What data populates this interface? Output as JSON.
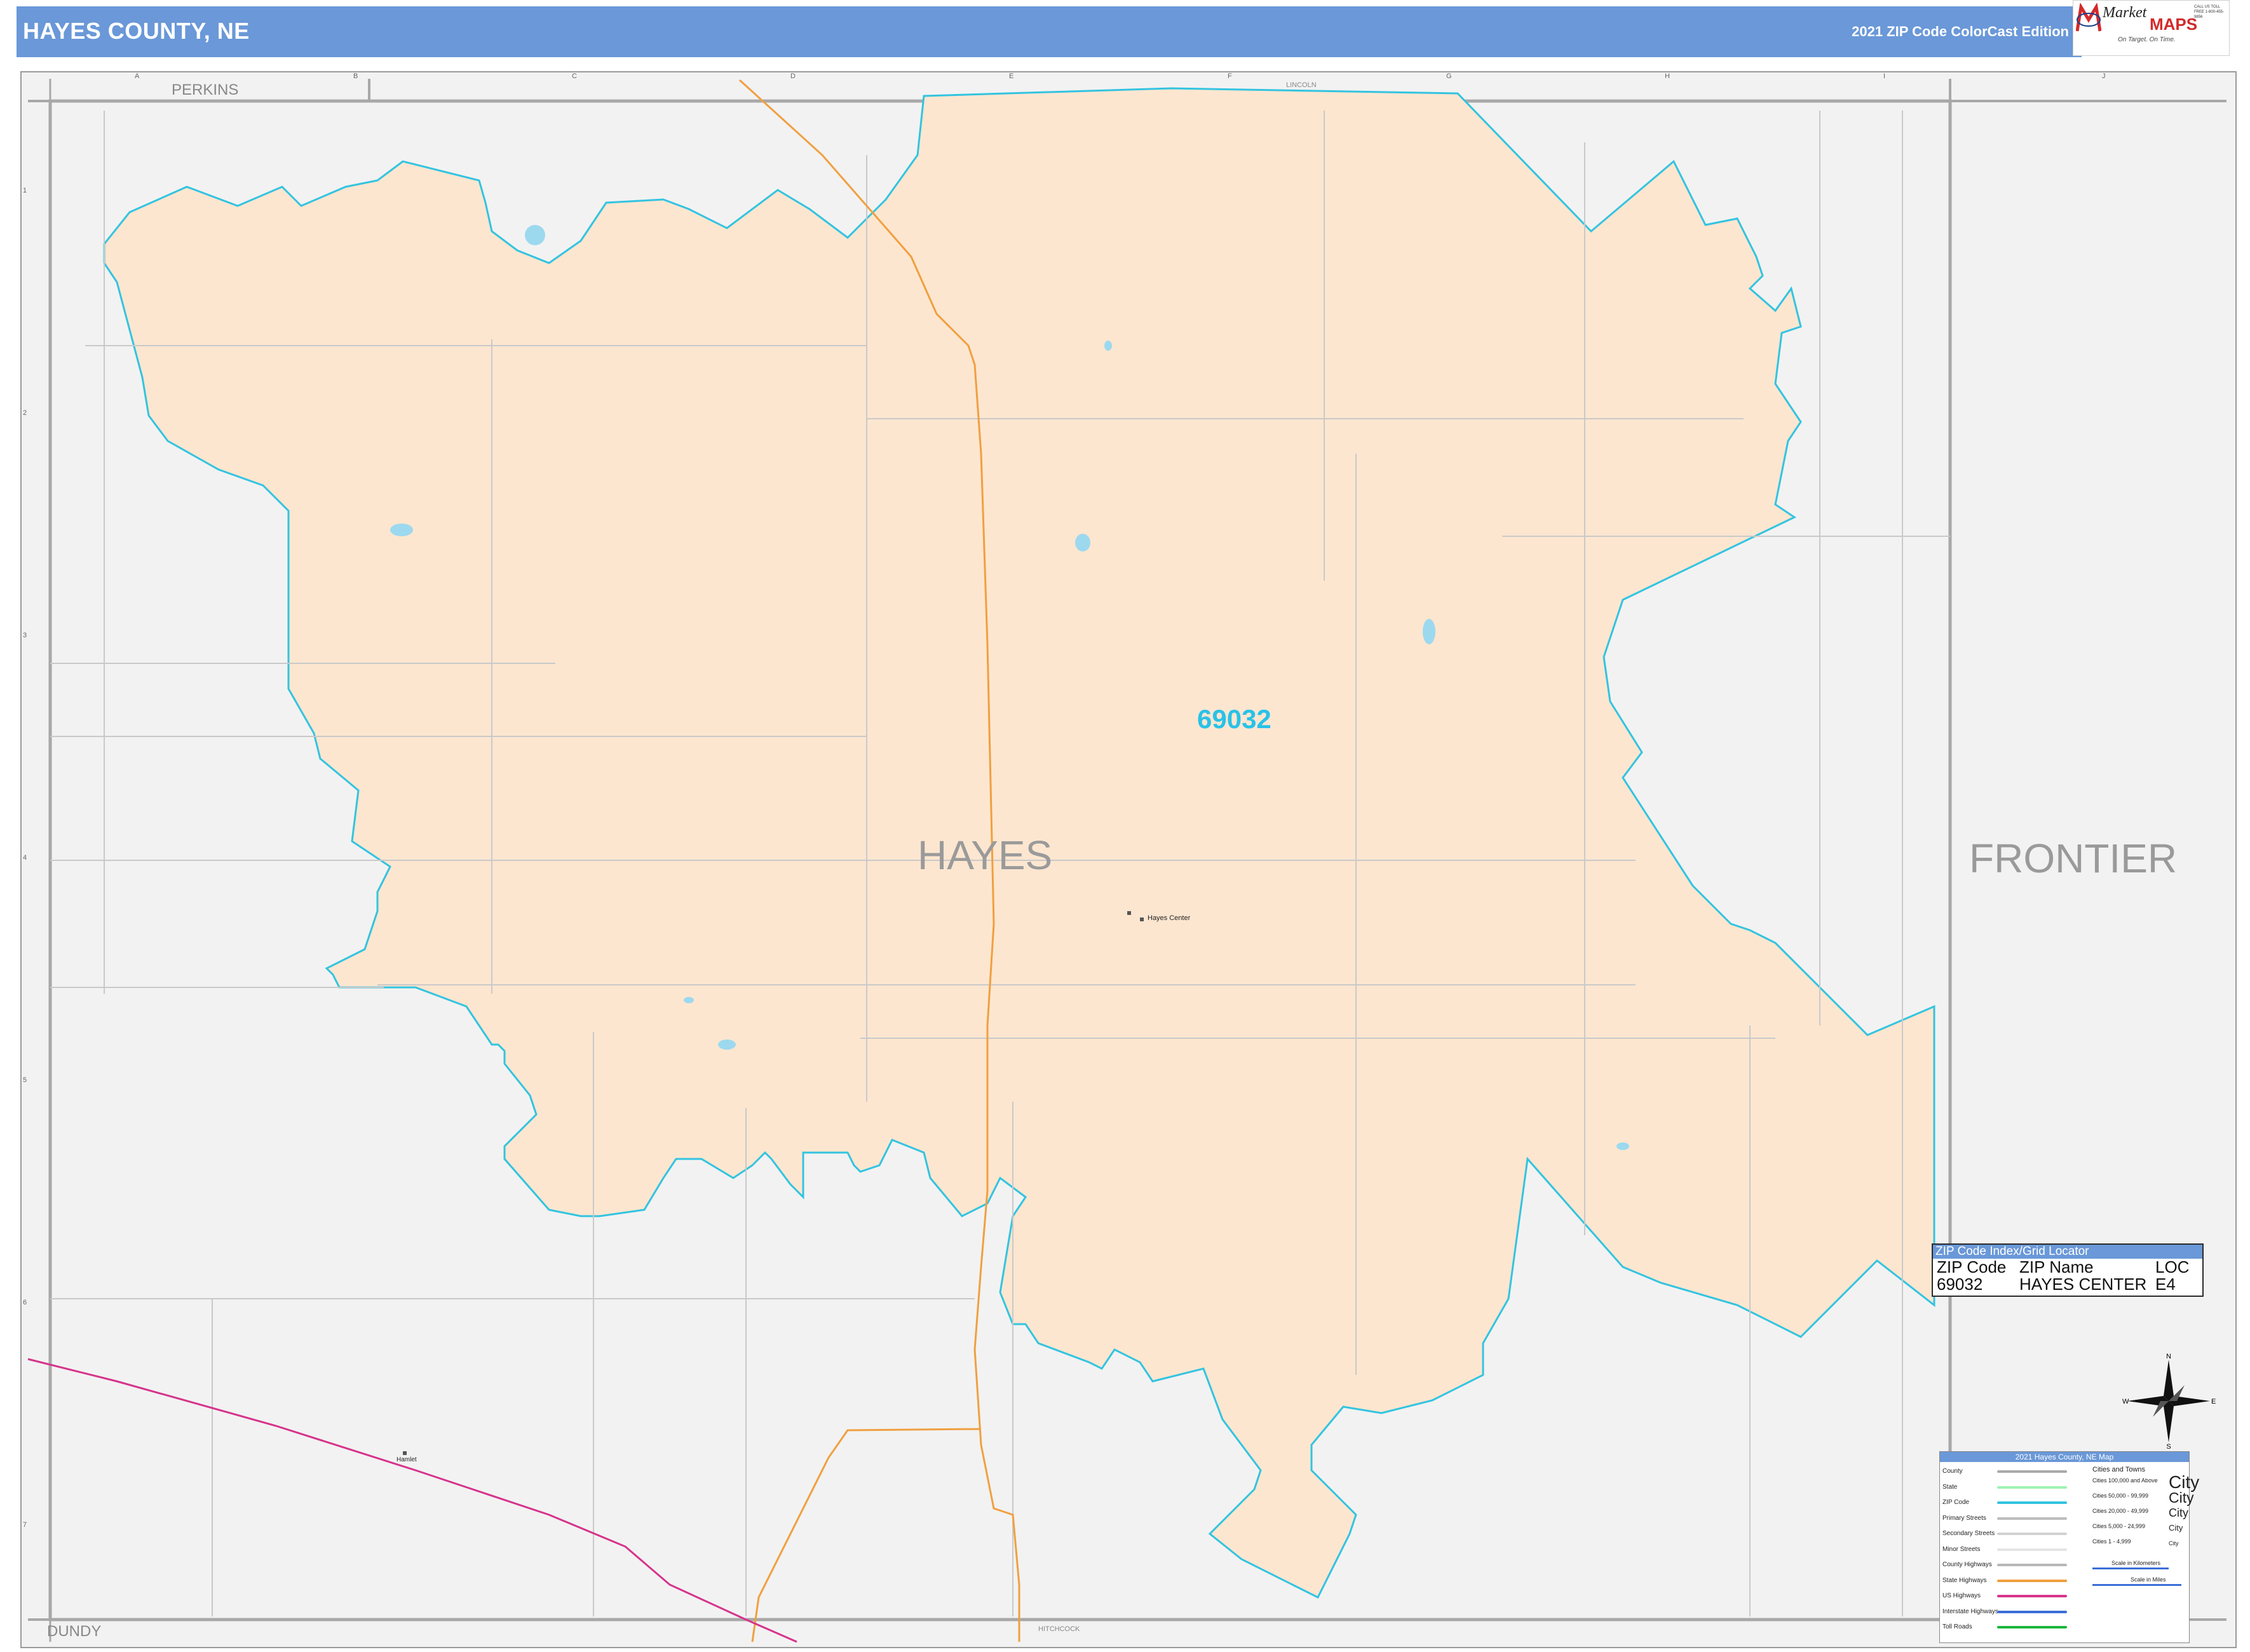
{
  "header": {
    "title": "HAYES COUNTY, NE",
    "edition": "2021 ZIP Code ColorCast Edition"
  },
  "logo": {
    "market": "Market",
    "maps": "MAPS",
    "tagline": "On Target. On Time.",
    "subtag": "America's Leading Source of Business Maps",
    "contact": "CALL US TOLL FREE 1-800-455-9856"
  },
  "grid": {
    "columns": [
      "A",
      "B",
      "C",
      "D",
      "E",
      "F",
      "G",
      "H",
      "I",
      "J"
    ],
    "rows": [
      "1",
      "2",
      "3",
      "4",
      "5",
      "6",
      "7"
    ]
  },
  "map_labels": {
    "county": "HAYES",
    "neighbor_east": "FRONTIER",
    "neighbor_nw": "PERKINS",
    "neighbor_sw": "DUNDY",
    "neighbor_n": "LINCOLN",
    "neighbor_s": "HITCHCOCK",
    "zip": "69032",
    "town_center": "Hayes Center",
    "town_sw": "Hamlet"
  },
  "zip_index": {
    "title": "ZIP Code Index/Grid Locator",
    "headers": [
      "ZIP Code",
      "ZIP Name",
      "LOC"
    ],
    "rows": [
      [
        "69032",
        "HAYES CENTER",
        "E4"
      ]
    ]
  },
  "legend": {
    "title": "2021 Hayes County, NE Map",
    "items": [
      {
        "label": "County",
        "color": "#aaaaaa"
      },
      {
        "label": "State",
        "color": "#9ff2b2"
      },
      {
        "label": "ZIP Code",
        "color": "#33c4e0"
      },
      {
        "label": "Primary Streets",
        "color": "#bdbdbd"
      },
      {
        "label": "Secondary Streets",
        "color": "#d2d2d2"
      },
      {
        "label": "Minor Streets",
        "color": "#e4e4e4"
      },
      {
        "label": "County Highways",
        "color": "#b8b8b8"
      },
      {
        "label": "State Highways",
        "color": "#f0a040"
      },
      {
        "label": "US Highways",
        "color": "#d6348c"
      },
      {
        "label": "Interstate Highways",
        "color": "#3c6ed8"
      },
      {
        "label": "Toll Roads",
        "color": "#1cb83c"
      }
    ],
    "cities_title": "Cities and Towns",
    "cities": [
      "Cities 100,000 and Above",
      "Cities 50,000 - 99,999",
      "Cities 20,000 - 49,999",
      "Cities 5,000 - 24,999",
      "Cities 1 - 4,999"
    ],
    "city_word": "City",
    "scale_km": "Scale in Kilometers",
    "scale_mi": "Scale in Miles"
  },
  "compass": {
    "n": "N",
    "s": "S",
    "e": "E",
    "w": "W"
  },
  "colors": {
    "header": "#6a98d8",
    "zip_fill": "#fde6d0",
    "zip_border": "#33c4e0",
    "zip_label": "#29c2e8",
    "background": "#f2f2f2",
    "us_highway": "#d6348c",
    "state_highway": "#f0a040",
    "water": "#9cd9ef"
  }
}
